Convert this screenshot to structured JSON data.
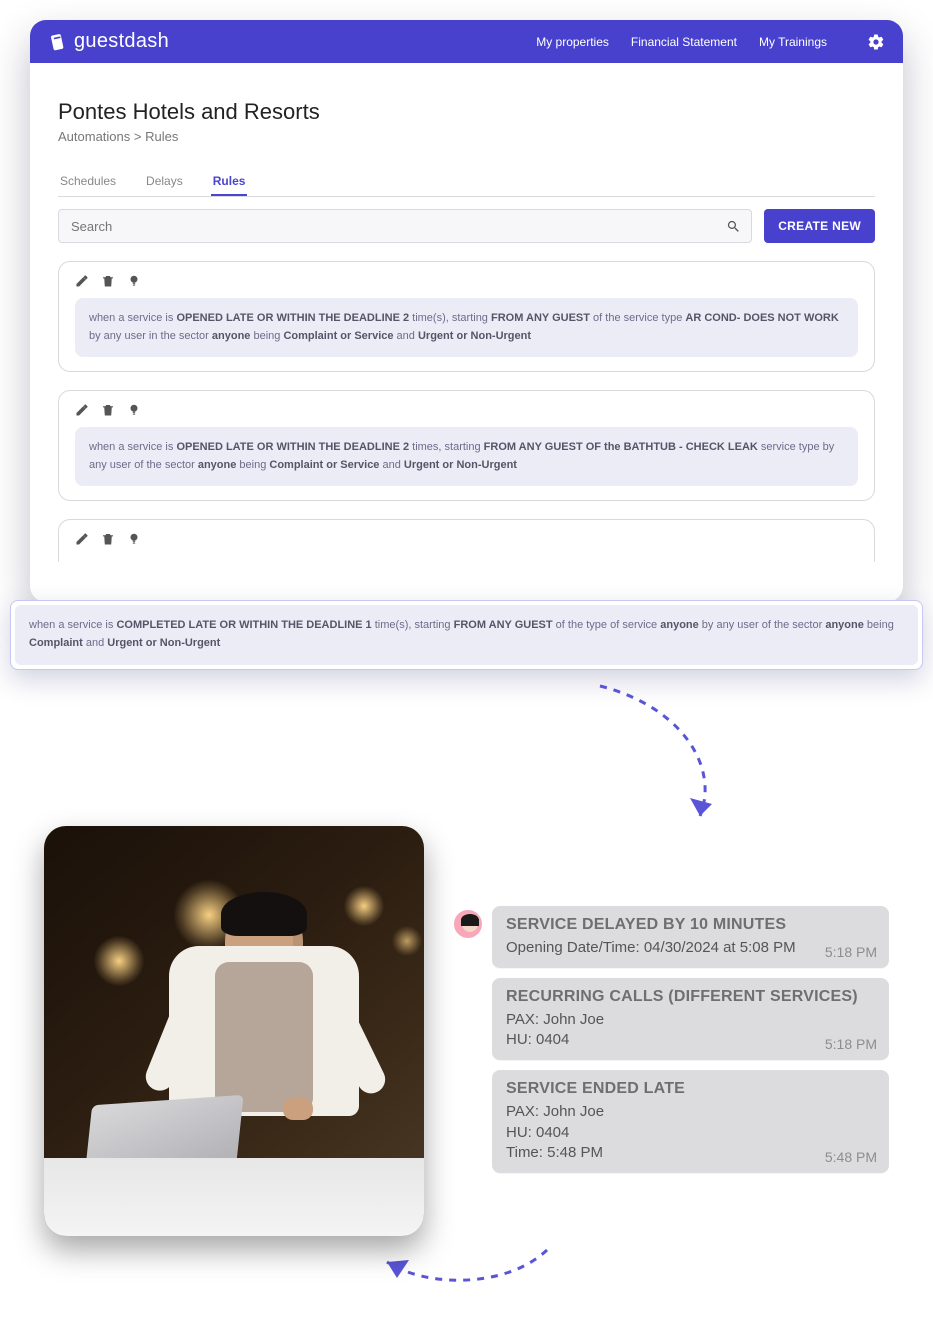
{
  "brand": "guestdash",
  "nav": {
    "properties": "My properties",
    "financial": "Financial Statement",
    "trainings": "My Trainings"
  },
  "page": {
    "title": "Pontes Hotels and Resorts",
    "breadcrumb": "Automations > Rules"
  },
  "tabs": {
    "schedules": "Schedules",
    "delays": "Delays",
    "rules": "Rules"
  },
  "search": {
    "placeholder": "Search"
  },
  "buttons": {
    "create": "CREATE NEW"
  },
  "rules": [
    {
      "t0": "when a service is ",
      "b0": "OPENED LATE OR WITHIN THE DEADLINE 2",
      "t1": " time(s), starting ",
      "b1": "FROM ANY GUEST",
      "t2": " of the service type ",
      "b2": "AR COND- DOES NOT WORK",
      "t3": " by any user in the sector ",
      "b3": "anyone",
      "t4": " being ",
      "b4": "Complaint or Service",
      "t5": " and ",
      "b5": "Urgent or Non-Urgent"
    },
    {
      "t0": "when a service is ",
      "b0": "OPENED LATE OR WITHIN THE DEADLINE 2",
      "t1": " times, starting ",
      "b1": "FROM ANY GUEST OF the BATHTUB - CHECK LEAK",
      "t2": " service type by any user of the sector ",
      "b2": "anyone",
      "t3": " being ",
      "b3": "Complaint or Service",
      "t4": " and ",
      "b4": "Urgent or Non-Urgent"
    },
    {
      "t0": "when a service is ",
      "b0": "COMPLETED LATE OR WITHIN THE DEADLINE 1",
      "t1": " time(s), starting ",
      "b1": "FROM ANY GUEST",
      "t2": " of the type of service ",
      "b2": "anyone",
      "t3": " by any user of the sector ",
      "b3": "anyone",
      "t4": " being ",
      "b4": "Complaint",
      "t5": " and ",
      "b5": "Urgent or Non-Urgent"
    }
  ],
  "chat": [
    {
      "title": "SERVICE DELAYED BY 10 MINUTES",
      "body": "Opening Date/Time: 04/30/2024 at 5:08 PM",
      "time": "5:18 PM"
    },
    {
      "title": "RECURRING CALLS (DIFFERENT SERVICES)",
      "l1": "PAX: John Joe",
      "l2": "HU: 0404",
      "time": "5:18 PM"
    },
    {
      "title": "SERVICE ENDED LATE",
      "l1": "PAX: John Joe",
      "l2": "HU: 0404",
      "l3": "Time: 5:48 PM",
      "time": "5:48 PM"
    }
  ]
}
